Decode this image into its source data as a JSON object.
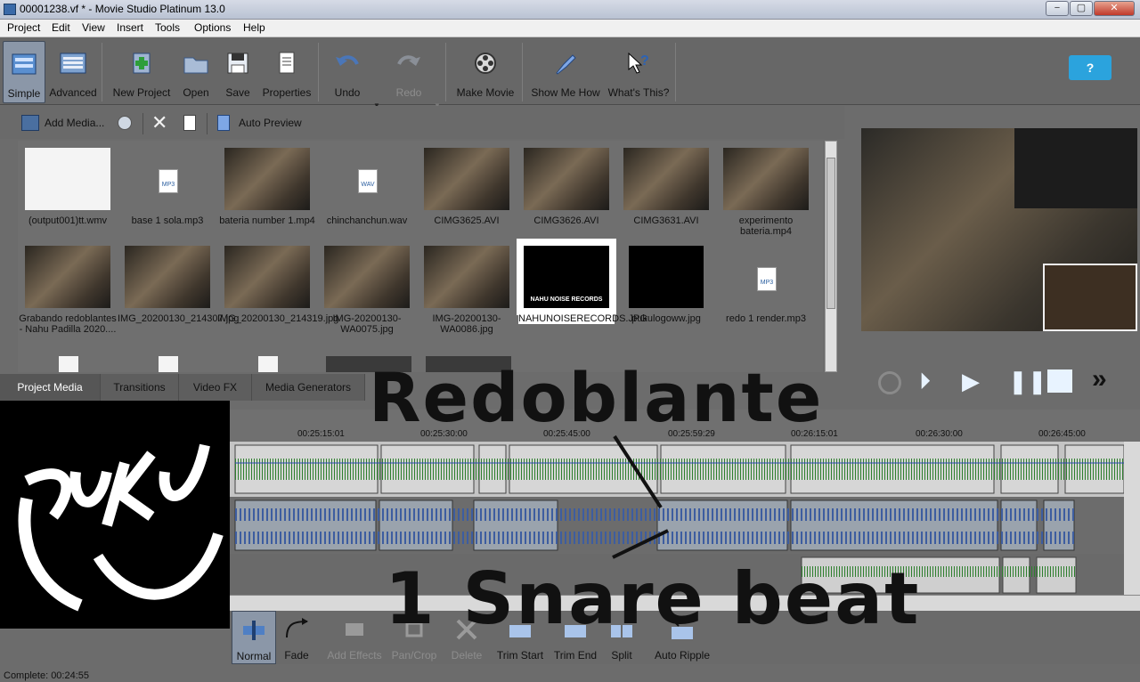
{
  "window": {
    "title": "00001238.vf * - Movie Studio Platinum 13.0",
    "min": "−",
    "max": "▢",
    "close": "✕"
  },
  "menu": [
    "Project",
    "Edit",
    "View",
    "Insert",
    "Tools",
    "Options",
    "Help"
  ],
  "toolbar": {
    "simple": "Simple",
    "advanced": "Advanced",
    "new_project": "New Project",
    "open": "Open",
    "save": "Save",
    "properties": "Properties",
    "undo": "Undo",
    "redo": "Redo",
    "make_movie": "Make Movie",
    "show_me_how": "Show Me How",
    "whats_this": "What's This?",
    "help_bubble": "?"
  },
  "media_toolbar": {
    "add_media": "Add Media...",
    "auto_preview": "Auto Preview"
  },
  "media": [
    {
      "name": "(output001)tt.wmv",
      "kind": "video"
    },
    {
      "name": "base 1 sola.mp3",
      "kind": "audio",
      "ext": "MP3"
    },
    {
      "name": "bateria number 1.mp4",
      "kind": "video"
    },
    {
      "name": "chinchanchun.wav",
      "kind": "audio",
      "ext": "WAV"
    },
    {
      "name": "CIMG3625.AVI",
      "kind": "video"
    },
    {
      "name": "CIMG3626.AVI",
      "kind": "video"
    },
    {
      "name": "CIMG3631.AVI",
      "kind": "video"
    },
    {
      "name": "experimento bateria.mp4",
      "kind": "video"
    },
    {
      "name": "Grabando redoblantes - Nahu Padilla 2020....",
      "kind": "video"
    },
    {
      "name": "IMG_20200130_214307.jpg",
      "kind": "image"
    },
    {
      "name": "IMG_20200130_214319.jpg",
      "kind": "image"
    },
    {
      "name": "IMG-20200130-WA0075.jpg",
      "kind": "image"
    },
    {
      "name": "IMG-20200130-WA0086.jpg",
      "kind": "image"
    },
    {
      "name": "NAHUNOISERECORDS.JPG",
      "kind": "logo",
      "logo_text": "NAHU NOISE RECORDS"
    },
    {
      "name": "pukulogoww.jpg",
      "kind": "logo2"
    },
    {
      "name": "redo 1 render.mp3",
      "kind": "audio",
      "ext": "MP3"
    }
  ],
  "tabs": [
    "Project Media",
    "Transitions",
    "Video FX",
    "Media Generators"
  ],
  "timeline": {
    "ruler": [
      "00:25:15:01",
      "00:25:30:00",
      "00:25:45:00",
      "00:25:59:29",
      "00:26:15:01",
      "00:26:30:00",
      "00:26:45:00"
    ]
  },
  "bottom_toolbar": [
    "Normal",
    "Fade",
    "Add Effects",
    "Pan/Crop",
    "Delete",
    "Trim Start",
    "Trim End",
    "Split",
    "Auto Ripple"
  ],
  "status": "Complete: 00:24:55",
  "overlay": {
    "line1": "Redoblante",
    "line2": "1 Snare beat"
  },
  "colors": {
    "toolbar": "#676767",
    "waveform_green": "#3a9a3a",
    "waveform_blue": "#4b6fb0"
  }
}
